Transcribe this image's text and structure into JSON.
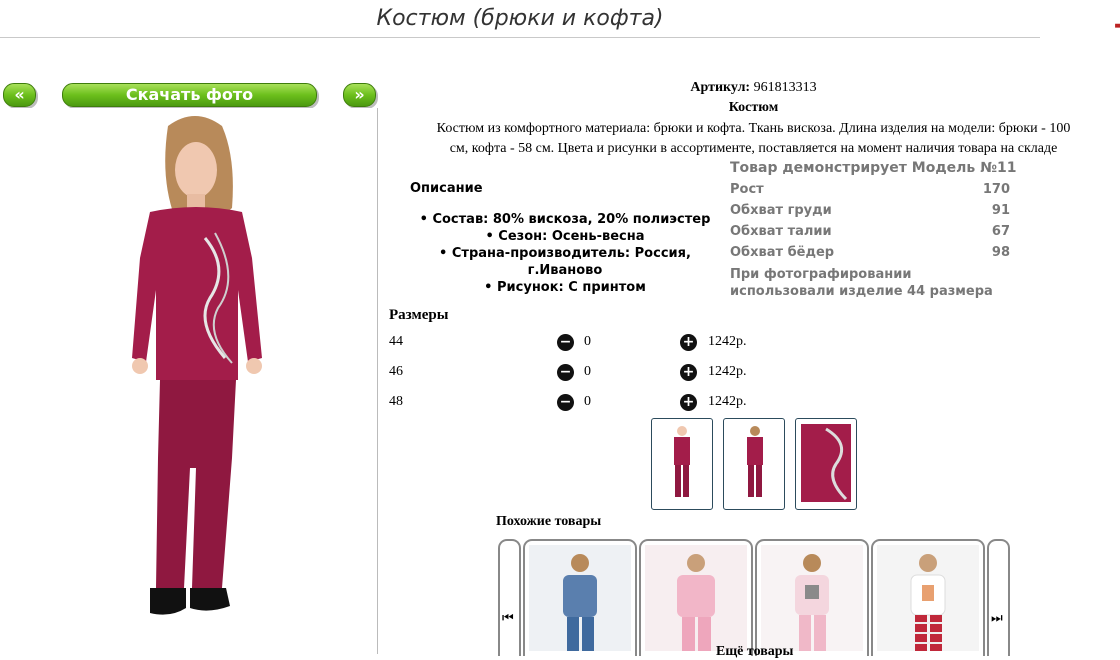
{
  "page": {
    "title": "Костюм (брюки и кофта)"
  },
  "nav": {
    "prev_label": "«",
    "download_label": "Скачать фото",
    "next_label": "»"
  },
  "product": {
    "article_label": "Артикул:",
    "article_value": "961813313",
    "name": "Костюм",
    "description_line1": "Костюм из комфортного материала: брюки и кофта. Ткань вискоза. Длина изделия на модели: брюки - 100",
    "description_line2": "см, кофта - 58 см. Цвета и рисунки в ассортименте, поставляется на момент наличия товара на складе",
    "desc_title": "Описание",
    "properties": [
      "Состав: 80% вискоза, 20% полиэстер",
      "Сезон: Осень-весна",
      "Страна-производитель: Россия, г.Иваново",
      "Рисунок: С принтом"
    ]
  },
  "model": {
    "heading": "Товар демонстрирует Модель №11",
    "rows": [
      {
        "label": "Рост",
        "value": "170"
      },
      {
        "label": "Обхват груди",
        "value": "91"
      },
      {
        "label": "Обхват талии",
        "value": "67"
      },
      {
        "label": "Обхват бёдер",
        "value": "98"
      }
    ],
    "note": "При фотографировании использовали изделие 44 размера"
  },
  "sizes": {
    "heading": "Размеры",
    "rows": [
      {
        "size": "44",
        "qty": "0",
        "price": "1242р."
      },
      {
        "size": "46",
        "qty": "0",
        "price": "1242р."
      },
      {
        "size": "48",
        "qty": "0",
        "price": "1242р."
      }
    ],
    "minus_symbol": "−",
    "plus_symbol": "+"
  },
  "similar": {
    "heading": "Похожие товары",
    "prev_symbol": "⏮",
    "next_symbol": "⏭",
    "more_label": "Ещё товары"
  },
  "colors": {
    "accent_green": "#6cbf1c",
    "garment": "#a31d4a"
  }
}
